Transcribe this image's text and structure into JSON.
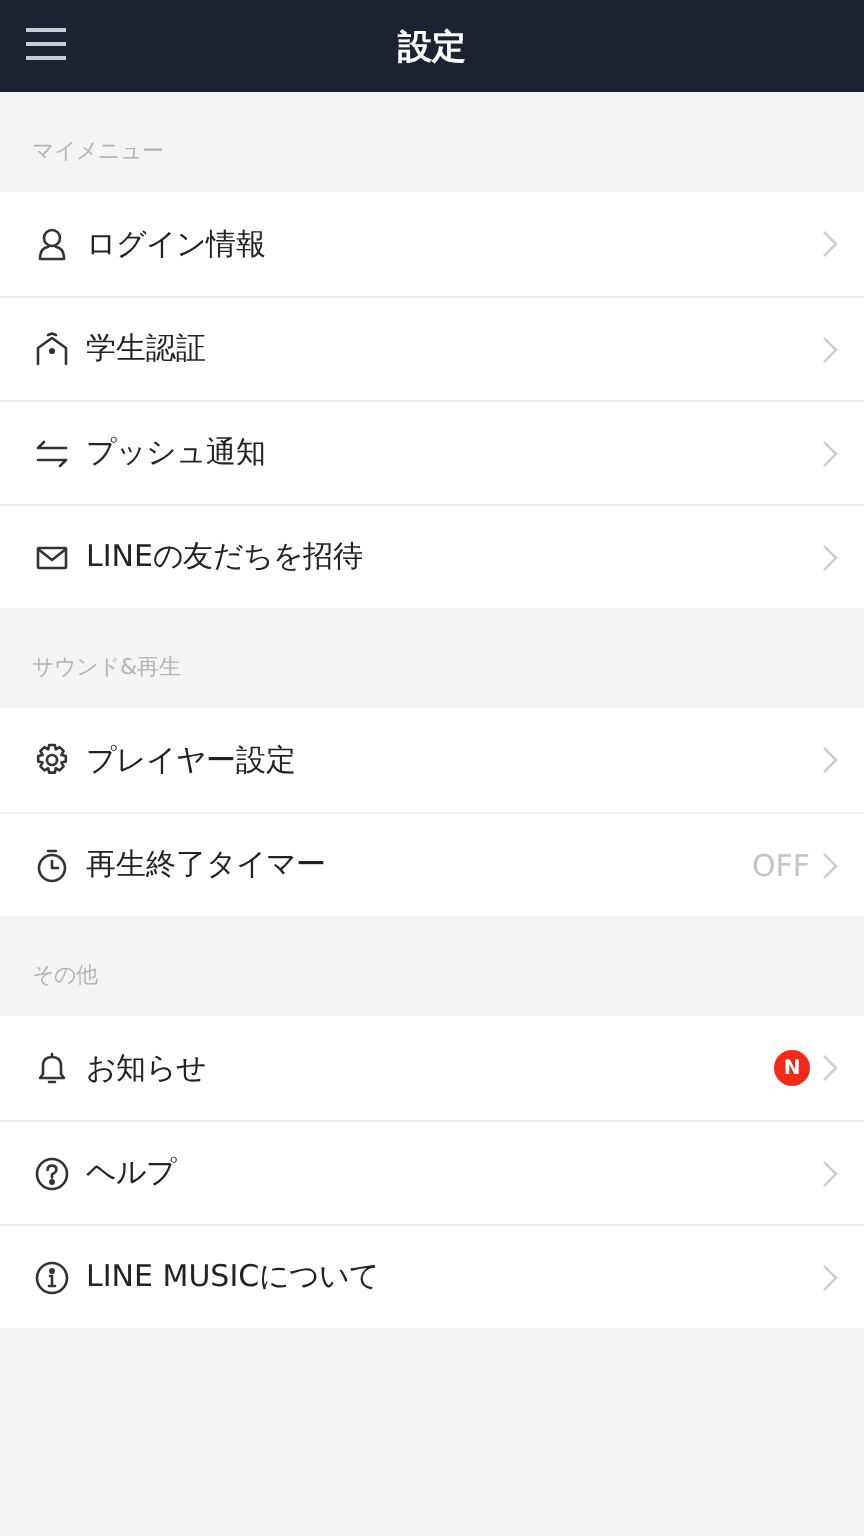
{
  "header": {
    "title": "設定"
  },
  "sections": [
    {
      "title": "マイメニュー",
      "items": [
        {
          "kind": "person",
          "label": "ログイン情報"
        },
        {
          "kind": "house",
          "label": "学生認証"
        },
        {
          "kind": "swap",
          "label": "プッシュ通知"
        },
        {
          "kind": "mail",
          "label": "LINEの友だちを招待"
        }
      ]
    },
    {
      "title": "サウンド&再生",
      "items": [
        {
          "kind": "gear",
          "label": "プレイヤー設定"
        },
        {
          "kind": "timer",
          "label": "再生終了タイマー",
          "value": "OFF"
        }
      ]
    },
    {
      "title": "その他",
      "items": [
        {
          "kind": "bell",
          "label": "お知らせ",
          "badge": "N"
        },
        {
          "kind": "help",
          "label": "ヘルプ"
        },
        {
          "kind": "info",
          "label": "LINE MUSICについて"
        }
      ]
    }
  ]
}
